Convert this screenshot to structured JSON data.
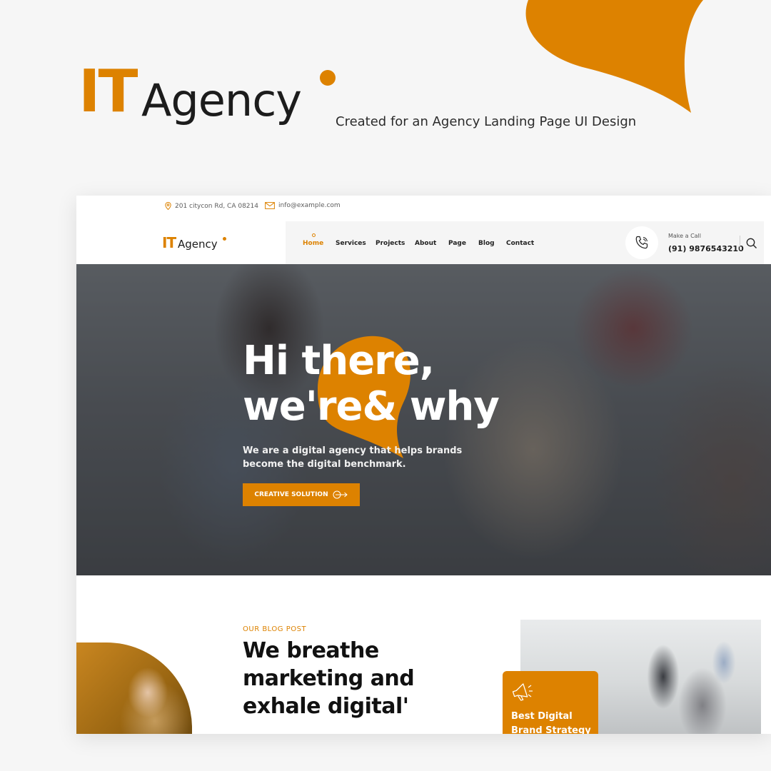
{
  "brand": {
    "it": "IT",
    "agency": "Agency",
    "tagline": "Created for an Agency Landing Page UI Design"
  },
  "colors": {
    "accent": "#dd8200",
    "text": "#1c1c1c",
    "background": "#f6f6f6"
  },
  "topbar": {
    "address": "201 citycon Rd, CA 08214",
    "address_icon": "location-pin-icon",
    "email": "info@example.com",
    "email_icon": "envelope-icon"
  },
  "nav": {
    "logo_it": "IT",
    "logo_agency": "Agency",
    "links": [
      {
        "label": "Home",
        "active": true
      },
      {
        "label": "Services",
        "active": false
      },
      {
        "label": "Projects",
        "active": false
      },
      {
        "label": "About",
        "active": false
      },
      {
        "label": "Page",
        "active": false
      },
      {
        "label": "Blog",
        "active": false
      },
      {
        "label": "Contact",
        "active": false
      }
    ],
    "call_label": "Make a Call",
    "call_number": "(91) 9876543210",
    "call_icon": "phone-icon",
    "search_icon": "search-icon"
  },
  "hero": {
    "title_line1": "Hi there,",
    "title_line2": "we're& why",
    "subtitle_line1": "We are a digital agency that helps brands",
    "subtitle_line2": "become the digital benchmark.",
    "button_label": "CREATIVE SOLUTION",
    "button_icon": "arrow-right-circle-icon"
  },
  "blog": {
    "kicker": "OUR BLOG POST",
    "title_line1": "We breathe",
    "title_line2": "marketing and",
    "title_line3": "exhale digital'",
    "card_icon": "megaphone-icon",
    "card_title_line1": "Best Digital",
    "card_title_line2": "Brand Strategy"
  }
}
